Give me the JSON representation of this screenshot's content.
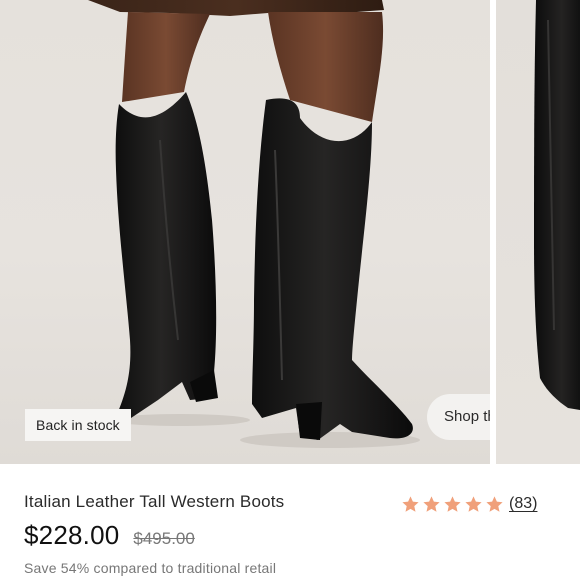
{
  "gallery": {
    "badge": "Back in stock",
    "shop_the_look": "Shop the Look"
  },
  "product": {
    "title": "Italian Leather Tall Western Boots",
    "price": "$228.00",
    "original_price": "$495.00",
    "savings": "Save 54% compared to traditional retail",
    "rating": {
      "stars": 5,
      "count": "(83)",
      "star_color": "#f0a07a"
    }
  }
}
